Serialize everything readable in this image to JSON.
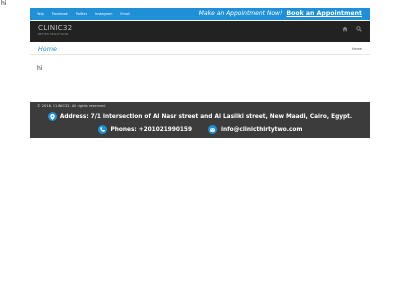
{
  "stray_text": "hi",
  "topbar": {
    "links": [
      "Yelp",
      "Facebook",
      "Twitter",
      "Instagram",
      "Email"
    ],
    "appointment_text": "Make an Appointment Now!",
    "appointment_button": "Book an Appointment"
  },
  "navbar": {
    "logo_name": "CLINIC32",
    "logo_tagline": "BETTER HEALTH NOW",
    "icons": [
      "home-icon",
      "search-icon"
    ]
  },
  "breadcrumb_bar": {
    "title": "Home",
    "crumb": "Home"
  },
  "content": {
    "text": "hi"
  },
  "footer": {
    "copyright": "© 2018, CLINIC32. All rights reserved.",
    "address_label": "Address: 7/1 Intersection of Al Nasr street and Al Lasilki street, New Maadi, Cairo, Egypt.",
    "phone_label": "Phones: +201021990159",
    "email": "info@clinicthirtytwo.com"
  },
  "colors": {
    "accent": "#1f8fd6",
    "nav_background": "#222222",
    "footer_background": "#3c3c3c"
  }
}
